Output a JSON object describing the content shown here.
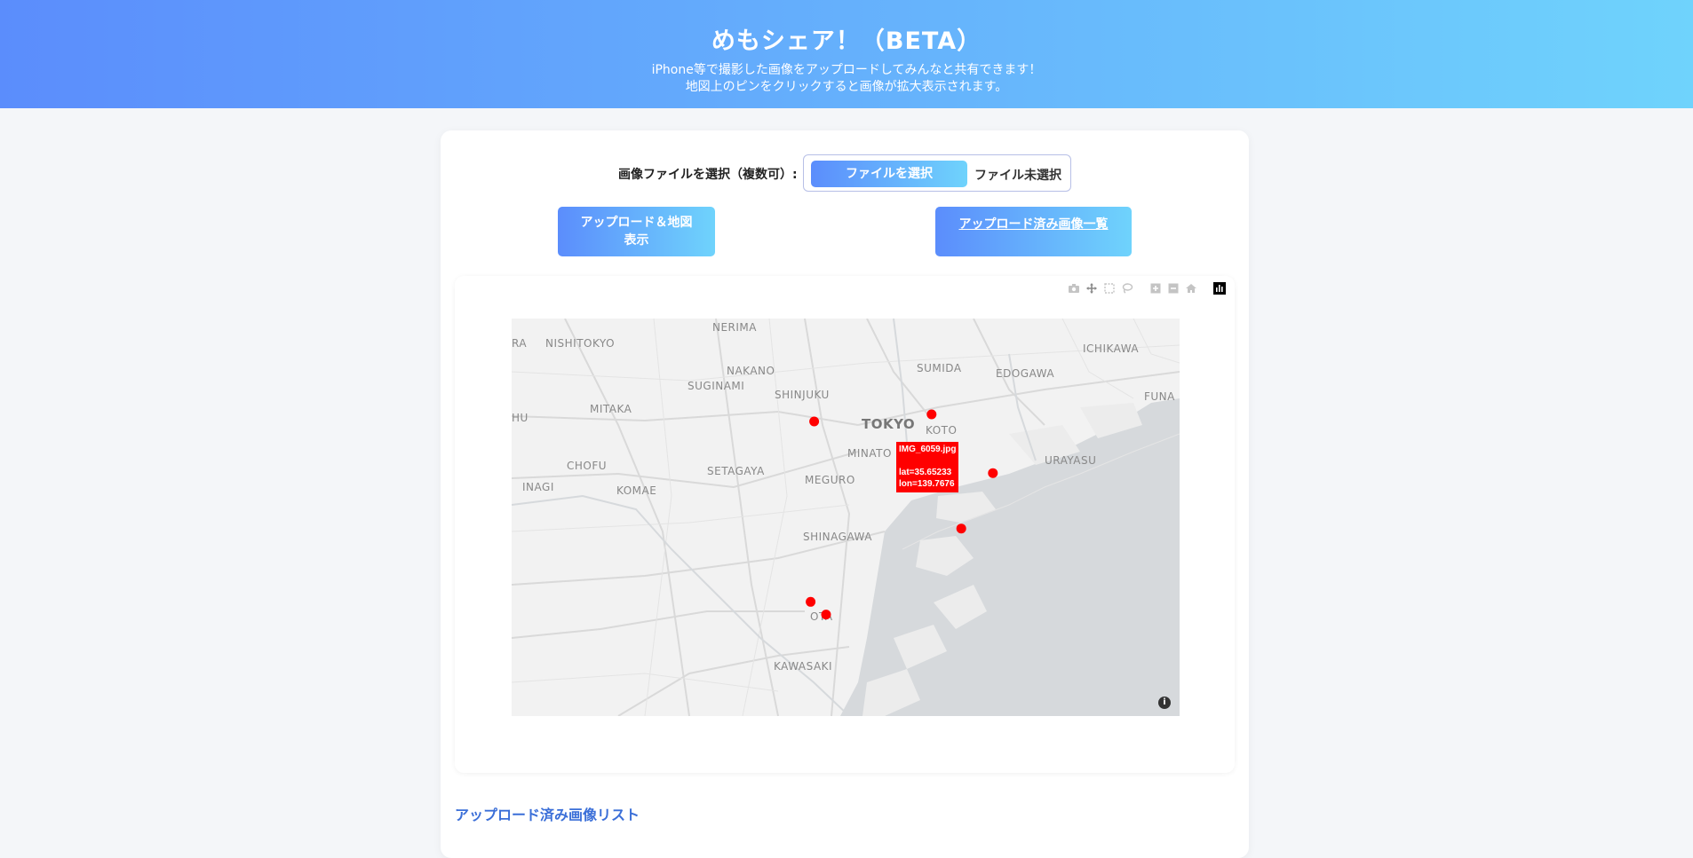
{
  "header": {
    "title": "めもシェア！（BETA）",
    "subtitle_line1": "iPhone等で撮影した画像をアップロードしてみんなと共有できます！",
    "subtitle_line2": "地図上のピンをクリックすると画像が拡大表示されます。"
  },
  "upload": {
    "file_label": "画像ファイルを選択（複数可）:",
    "file_button": "ファイルを選択",
    "file_status": "ファイル未選択",
    "upload_button": "アップロード＆地図表示",
    "list_button": "アップロード済み画像一覧"
  },
  "map": {
    "modebar_icons": [
      "camera-icon",
      "pan-icon",
      "box-select-icon",
      "lasso-icon",
      "zoom-in-icon",
      "zoom-out-icon",
      "home-icon",
      "plotly-logo-icon"
    ],
    "labels": [
      "NERIMA",
      "NISHITOKYO",
      "RA",
      "NAKANO",
      "SUGINAMI",
      "SHINJUKU",
      "SUMIDA",
      "EDOGAWA",
      "ICHIKAWA",
      "MITAKA",
      "TOKYO",
      "KOTO",
      "FUNA",
      "HU",
      "CHOFU",
      "MINATO",
      "URAYASU",
      "INAGI",
      "SETAGAYA",
      "MEGURO",
      "KOMAE",
      "SHINAGAWA",
      "OTA",
      "KAWASAKI"
    ],
    "pins": [
      {
        "name": "pin-1",
        "lat": 35.689,
        "lon": 139.617
      },
      {
        "name": "pin-2",
        "lat": 35.694,
        "lon": 139.716
      },
      {
        "name": "pin-3",
        "lat": 35.65233,
        "lon": 139.7676
      },
      {
        "name": "pin-4",
        "lat": 35.613,
        "lon": 139.741
      },
      {
        "name": "pin-5",
        "lat": 35.561,
        "lon": 139.614
      },
      {
        "name": "pin-6",
        "lat": 35.552,
        "lon": 139.627
      }
    ],
    "tooltip": {
      "filename": "IMG_6059.jpg",
      "lat": "lat=35.65233",
      "lon": "lon=139.7676"
    },
    "info_icon": "i",
    "pin_color": "#ff0000"
  },
  "list_section": {
    "title": "アップロード済み画像リスト"
  }
}
